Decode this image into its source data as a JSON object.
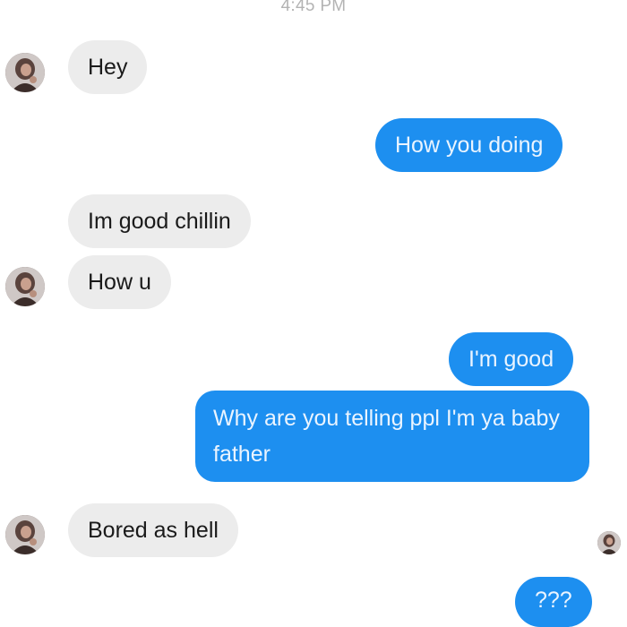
{
  "timestamp": "4:45 PM",
  "messages": [
    {
      "side": "incoming",
      "text": "Hey"
    },
    {
      "side": "outgoing",
      "text": "How you doing"
    },
    {
      "side": "incoming",
      "text": "Im good chillin"
    },
    {
      "side": "incoming",
      "text": "How u"
    },
    {
      "side": "outgoing",
      "text": "I'm good"
    },
    {
      "side": "outgoing",
      "text": "Why are you telling ppl I'm ya baby father"
    },
    {
      "side": "incoming",
      "text": "Bored as hell"
    },
    {
      "side": "outgoing",
      "text": "???"
    }
  ],
  "colors": {
    "incoming_bubble": "#ececec",
    "outgoing_bubble": "#1d8ff0",
    "timestamp": "#b3b3b3"
  },
  "icons": {
    "contact_avatar": "avatar-icon",
    "read_receipt": "read-receipt-avatar-icon"
  }
}
